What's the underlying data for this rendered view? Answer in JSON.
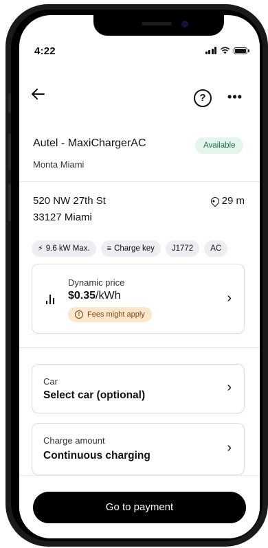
{
  "status_bar": {
    "time": "4:22"
  },
  "header": {
    "back_icon": "arrow-left-icon",
    "help_label": "?",
    "more_label": "•••"
  },
  "charger": {
    "name": "Autel - MaxiChargerAC",
    "status": "Available",
    "operator": "Monta Miami",
    "status_color": "#e4f6ec"
  },
  "location": {
    "address_line1": "520 NW 27th St",
    "address_line2": "33127 Miami",
    "distance": "29 m"
  },
  "tags": [
    {
      "icon": "bolt-icon",
      "glyph": "⚡",
      "label": "9.6 kW Max."
    },
    {
      "icon": "nfc-icon",
      "glyph": "≡",
      "label": "Charge key"
    },
    {
      "icon": "",
      "glyph": "",
      "label": "J1772"
    },
    {
      "icon": "",
      "glyph": "",
      "label": "AC"
    }
  ],
  "price": {
    "label": "Dynamic price",
    "amount": "$0.35",
    "unit": "/kWh",
    "fees_note": "Fees might apply",
    "fees_color": "#fde7cc"
  },
  "car": {
    "label": "Car",
    "value": "Select car (optional)"
  },
  "charge_amount": {
    "label": "Charge amount",
    "value": "Continuous charging"
  },
  "cta": {
    "label": "Go to payment"
  }
}
